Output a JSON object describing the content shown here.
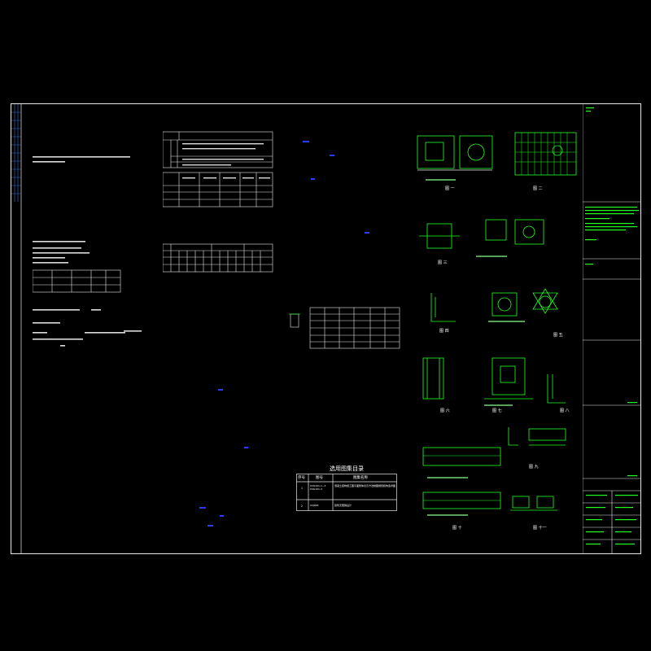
{
  "catalog": {
    "title": "选用图集目录",
    "headers": [
      "序号",
      "图号",
      "图集名称"
    ],
    "rows": [
      {
        "no": "1",
        "code": "03G101-1~3 04G101-3",
        "name": "混凝土结构施工图平面整体表示方法制图规则和构造详图"
      },
      {
        "no": "2",
        "code": "03J926",
        "name": "建筑无障碍设计"
      }
    ]
  },
  "figures": {
    "fig1": "图 一",
    "fig2": "图 二",
    "fig3": "图 三",
    "fig4": "图 四",
    "fig5": "图 五",
    "fig6": "图 六",
    "fig7": "图 七",
    "fig8": "图 八",
    "fig9": "图 九",
    "fig10": "图 十",
    "fig11": "图 十一"
  },
  "colors": {
    "background": "#000000",
    "frame": "#e8e8e8",
    "drawing": "#22ff22",
    "annotation": "#2a3cff",
    "text": "#ffffff"
  }
}
